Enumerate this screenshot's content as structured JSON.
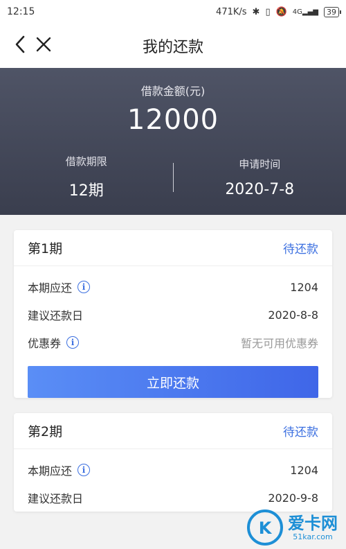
{
  "status_bar": {
    "time": "12:15",
    "network_speed": "471K/s",
    "signal_label": "4G",
    "battery": "39"
  },
  "nav": {
    "title": "我的还款"
  },
  "hero": {
    "amount_label": "借款金额(元)",
    "amount": "12000",
    "term_label": "借款期限",
    "term_value": "12期",
    "apply_label": "申请时间",
    "apply_value": "2020-7-8"
  },
  "installments": [
    {
      "title": "第1期",
      "status": "待还款",
      "due_label": "本期应还",
      "due_value": "1204",
      "date_label": "建议还款日",
      "date_value": "2020-8-8",
      "coupon_label": "优惠券",
      "coupon_value": "暂无可用优惠券",
      "pay_label": "立即还款"
    },
    {
      "title": "第2期",
      "status": "待还款",
      "due_label": "本期应还",
      "due_value": "1204",
      "date_label": "建议还款日",
      "date_value": "2020-9-8"
    }
  ],
  "watermark": {
    "name": "爱卡网",
    "url": "51kar.com"
  },
  "colors": {
    "accent": "#3b6fe0",
    "hero_bg": "#474b5c"
  }
}
